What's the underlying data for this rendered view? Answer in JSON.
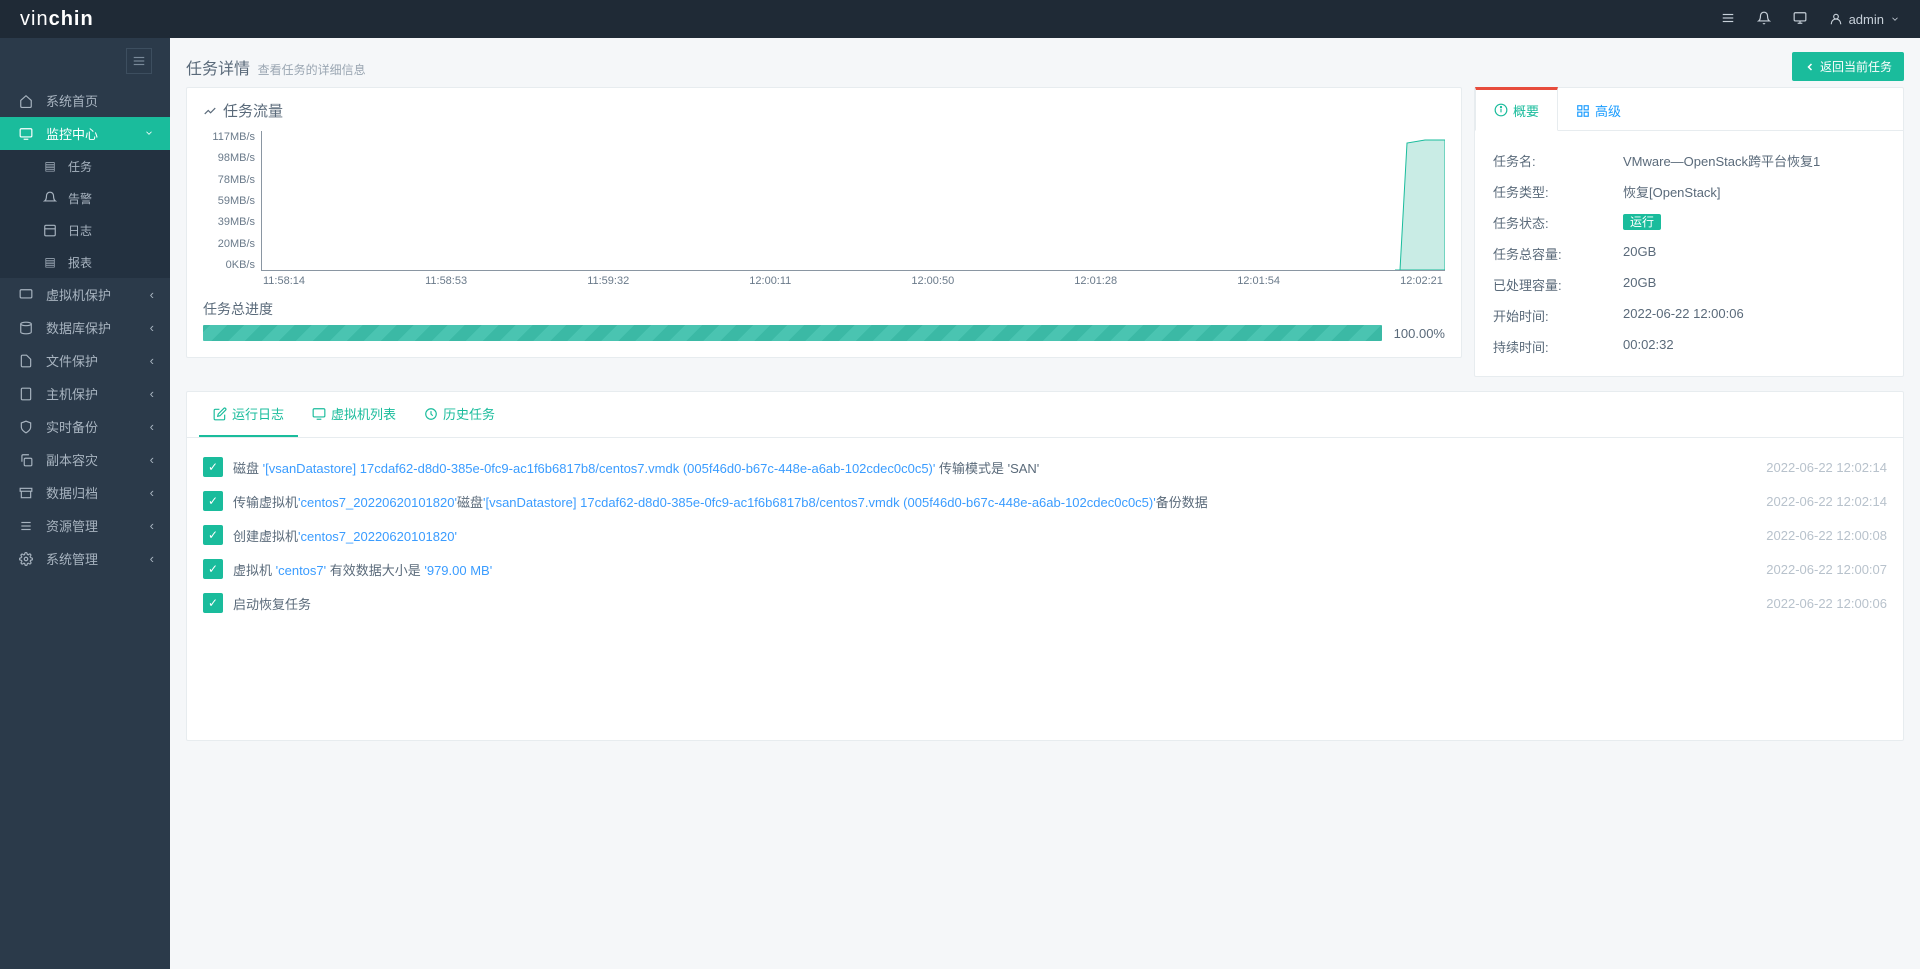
{
  "brand": {
    "part1": "vin",
    "part2": "chin"
  },
  "user": {
    "name": "admin"
  },
  "sidebar": {
    "items": [
      {
        "label": "系统首页"
      },
      {
        "label": "监控中心"
      },
      {
        "label": "虚拟机保护"
      },
      {
        "label": "数据库保护"
      },
      {
        "label": "文件保护"
      },
      {
        "label": "主机保护"
      },
      {
        "label": "实时备份"
      },
      {
        "label": "副本容灾"
      },
      {
        "label": "数据归档"
      },
      {
        "label": "资源管理"
      },
      {
        "label": "系统管理"
      }
    ],
    "sub": [
      {
        "label": "任务"
      },
      {
        "label": "告警"
      },
      {
        "label": "日志"
      },
      {
        "label": "报表"
      }
    ]
  },
  "header": {
    "title": "任务详情",
    "subtitle": "查看任务的详细信息",
    "back_btn": "返回当前任务"
  },
  "chart": {
    "title": "任务流量"
  },
  "chart_data": {
    "type": "area",
    "title": "任务流量",
    "xlabel": "",
    "ylabel": "",
    "y_ticks": [
      "117MB/s",
      "98MB/s",
      "78MB/s",
      "59MB/s",
      "39MB/s",
      "20MB/s",
      "0KB/s"
    ],
    "x_ticks": [
      "11:58:14",
      "11:58:53",
      "11:59:32",
      "12:00:11",
      "12:00:50",
      "12:01:28",
      "12:01:54",
      "12:02:21"
    ],
    "ylim": [
      0,
      117
    ],
    "x": [
      "11:58:14",
      "11:58:53",
      "11:59:32",
      "12:00:11",
      "12:00:50",
      "12:01:28",
      "12:01:54",
      "12:02:05",
      "12:02:10",
      "12:02:21",
      "12:02:38"
    ],
    "values": [
      0,
      0,
      0,
      0,
      0,
      0,
      0,
      0,
      110,
      113,
      113
    ]
  },
  "progress": {
    "title": "任务总进度",
    "percent": "100.00%"
  },
  "info_tabs": {
    "overview": "概要",
    "advanced": "高级"
  },
  "info": {
    "rows": [
      {
        "label": "任务名:",
        "value": "VMware—OpenStack跨平台恢复1"
      },
      {
        "label": "任务类型:",
        "value": "恢复[OpenStack]"
      },
      {
        "label": "任务状态:",
        "value": "运行",
        "badge": true
      },
      {
        "label": "任务总容量:",
        "value": "20GB"
      },
      {
        "label": "已处理容量:",
        "value": "20GB"
      },
      {
        "label": "开始时间:",
        "value": "2022-06-22 12:00:06"
      },
      {
        "label": "持续时间:",
        "value": "00:02:32"
      }
    ]
  },
  "btabs": {
    "log": "运行日志",
    "vmlist": "虚拟机列表",
    "history": "历史任务"
  },
  "logs": [
    {
      "pre": "磁盘 ",
      "hl": "'[vsanDatastore] 17cdaf62-d8d0-385e-0fc9-ac1f6b6817b8/centos7.vmdk (005f46d0-b67c-448e-a6ab-102cdec0c0c5)'",
      "post": " 传输模式是 'SAN'",
      "time": "2022-06-22 12:02:14"
    },
    {
      "pre": "传输虚拟机",
      "hl": "'centos7_20220620101820'",
      "mid": "磁盘",
      "hl2": "'[vsanDatastore] 17cdaf62-d8d0-385e-0fc9-ac1f6b6817b8/centos7.vmdk (005f46d0-b67c-448e-a6ab-102cdec0c0c5)'",
      "post": "备份数据",
      "time": "2022-06-22 12:02:14"
    },
    {
      "pre": "创建虚拟机",
      "hl": "'centos7_20220620101820'",
      "post": "",
      "time": "2022-06-22 12:00:08"
    },
    {
      "pre": "虚拟机 ",
      "hl": "'centos7'",
      "mid": " 有效数据大小是 ",
      "hl2": "'979.00 MB'",
      "post": "",
      "time": "2022-06-22 12:00:07"
    },
    {
      "pre": "启动恢复任务",
      "hl": "",
      "post": "",
      "time": "2022-06-22 12:00:06"
    }
  ]
}
